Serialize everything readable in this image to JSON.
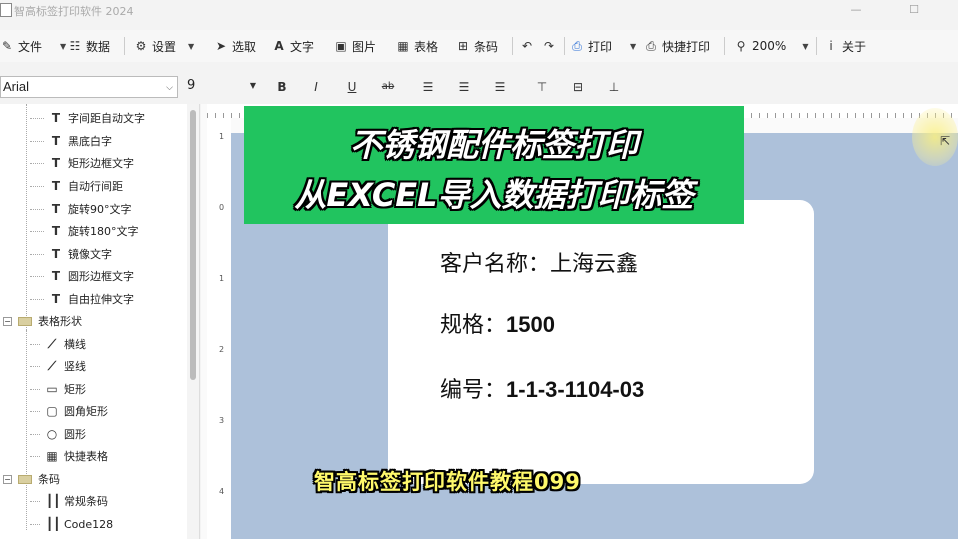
{
  "window": {
    "title": "智高标签打印软件 2024",
    "minimize": "—",
    "maximize": "☐"
  },
  "toolbar": {
    "file": "文件",
    "data": "数据",
    "settings": "设置",
    "select": "选取",
    "text": "文字",
    "image": "图片",
    "table": "表格",
    "barcode": "条码",
    "print": "打印",
    "quick_print": "快捷打印",
    "zoom": "200%",
    "about": "关于"
  },
  "format_bar": {
    "font_name": "Arial",
    "font_size": "9",
    "bold": "B",
    "italic": "I",
    "underline": "U",
    "strike": "ab"
  },
  "tree": {
    "text_items": [
      "字间距自动文字",
      "黑底白字",
      "矩形边框文字",
      "自动行间距",
      "旋转90°文字",
      "旋转180°文字",
      "镜像文字",
      "圆形边框文字",
      "自由拉伸文字"
    ],
    "shape_group": "表格形状",
    "shape_items": [
      "横线",
      "竖线",
      "矩形",
      "圆角矩形",
      "圆形",
      "快捷表格"
    ],
    "barcode_group": "条码",
    "barcode_items": [
      "常规条码",
      "Code128"
    ]
  },
  "rulers": {
    "left_marks": [
      "1",
      "0",
      "1",
      "2",
      "3",
      "4"
    ]
  },
  "label": {
    "customer_label": "客户名称：",
    "customer_value": "上海云鑫",
    "spec_label": "规格：",
    "spec_value": "1500",
    "serial_label": "编号：",
    "serial_value": "1-1-3-1104-03"
  },
  "overlay": {
    "banner_line1": "不锈钢配件标签打印",
    "banner_line2": "从EXCEL导入数据打印标签",
    "caption": "智高标签打印软件教程099",
    "banner_color": "#21c45f",
    "caption_color": "#fff96b"
  },
  "colors": {
    "canvas_bg": "#adc1da",
    "label_bg": "#ffffff"
  }
}
